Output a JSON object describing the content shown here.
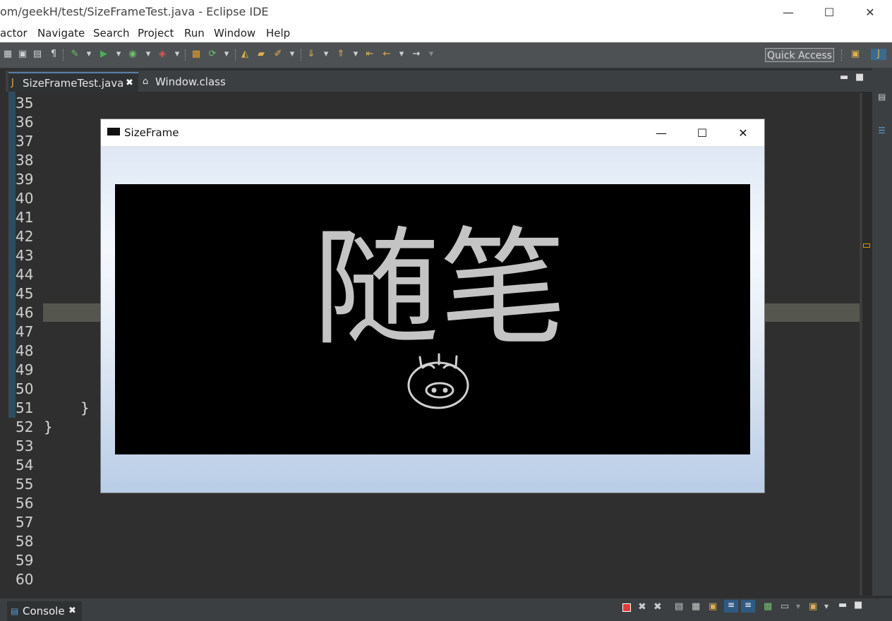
{
  "window": {
    "title": "om/geekH/test/SizeFrameTest.java - Eclipse IDE",
    "minimize": "—",
    "maximize": "☐",
    "close": "✕"
  },
  "menu": [
    "actor",
    "Navigate",
    "Search",
    "Project",
    "Run",
    "Window",
    "Help"
  ],
  "toolbar": {
    "quick_access": "Quick Access"
  },
  "tabs": [
    {
      "label": "SizeFrameTest.java",
      "close": "✖"
    },
    {
      "label": "Window.class"
    }
  ],
  "editor": {
    "line_numbers": [
      "35",
      "36",
      "37",
      "38",
      "39",
      "40",
      "41",
      "42",
      "43",
      "44",
      "45",
      "46",
      "47",
      "48",
      "49",
      "50",
      "51",
      "52",
      "53",
      "54",
      "55",
      "56",
      "57",
      "58",
      "59",
      "60"
    ],
    "brace_inner": "}",
    "brace_outer": "}"
  },
  "frame": {
    "title": "SizeFrame",
    "minimize": "—",
    "maximize": "☐",
    "close": "✕",
    "image_text": "随笔"
  },
  "console": {
    "label": "Console",
    "close": "✖"
  }
}
